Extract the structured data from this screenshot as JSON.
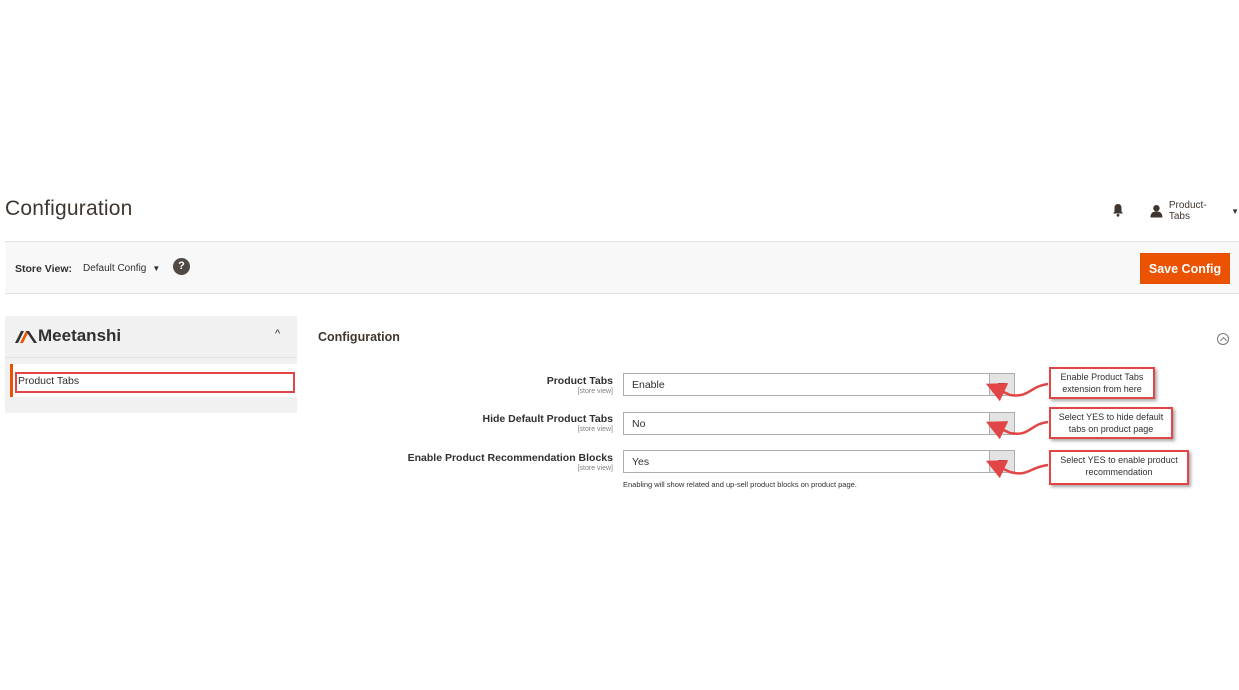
{
  "header": {
    "title": "Configuration",
    "user_name": "Product-Tabs"
  },
  "store_bar": {
    "label": "Store View:",
    "selected_scope": "Default Config",
    "help_glyph": "?",
    "save_label": "Save Config"
  },
  "sidebar": {
    "brand": "Meetanshi",
    "items": [
      {
        "label": "Product Tabs"
      }
    ]
  },
  "section": {
    "title": "Configuration",
    "fields": [
      {
        "label": "Product Tabs",
        "scope": "[store view]",
        "value": "Enable"
      },
      {
        "label": "Hide Default Product Tabs",
        "scope": "[store view]",
        "value": "No"
      },
      {
        "label": "Enable Product Recommendation Blocks",
        "scope": "[store view]",
        "value": "Yes"
      }
    ],
    "note": "Enabling will show related and up-sell product blocks on product page."
  },
  "callouts": [
    {
      "line1": "Enable Product Tabs",
      "line2": "extension from here"
    },
    {
      "line1": "Select YES to hide default",
      "line2": "tabs on product page"
    },
    {
      "line1": "Select YES to enable product",
      "line2": "recommendation"
    }
  ],
  "colors": {
    "accent": "#eb5202",
    "annotation": "#e24545",
    "bar_background": "#f8f8f8",
    "sidebar_background": "#f1f1f1"
  },
  "icons": [
    "bell-icon",
    "user-icon",
    "help-icon",
    "meetanshi-logo-icon",
    "chevron-up-icon",
    "collapse-icon",
    "dropdown-arrow-icon"
  ]
}
